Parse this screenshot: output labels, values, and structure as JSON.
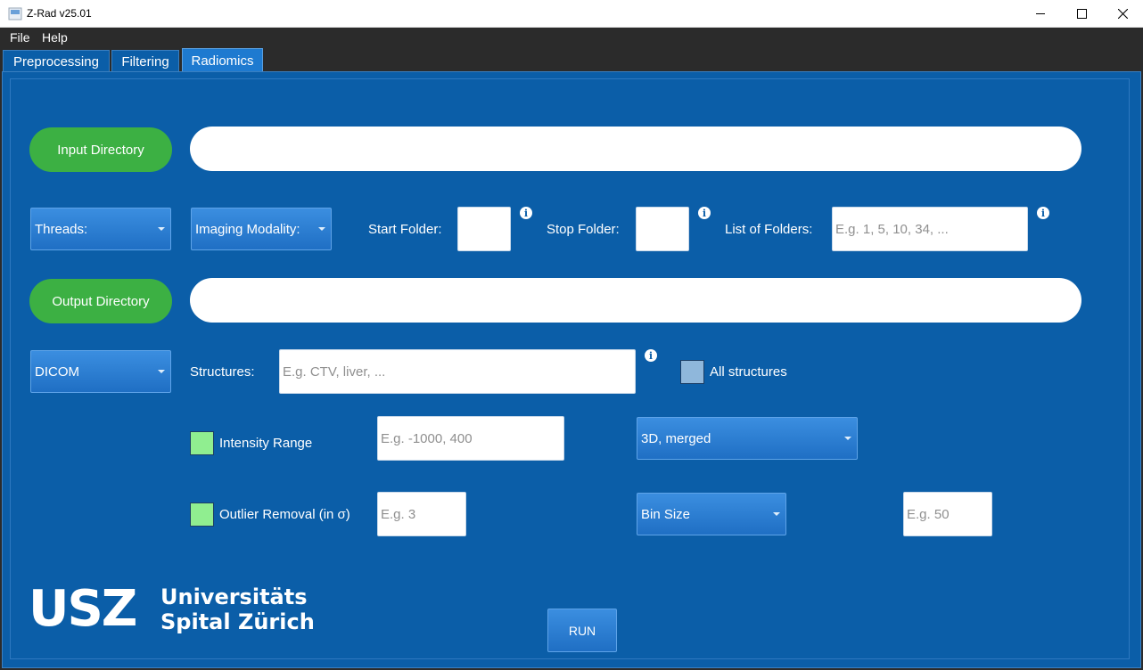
{
  "window": {
    "title": "Z-Rad v25.01",
    "accent": "#0b5ea8",
    "button_green": "#3cb043"
  },
  "menu": [
    "File",
    "Help"
  ],
  "tabs": [
    {
      "label": "Preprocessing",
      "active": false
    },
    {
      "label": "Filtering",
      "active": false
    },
    {
      "label": "Radiomics",
      "active": true
    }
  ],
  "input_dir": {
    "button": "Input Directory",
    "value": ""
  },
  "output_dir": {
    "button": "Output Directory",
    "value": ""
  },
  "row1": {
    "threads": "Threads:",
    "imaging_modality": "Imaging Modality:",
    "start_folder_label": "Start Folder:",
    "start_folder_value": "",
    "stop_folder_label": "Stop Folder:",
    "stop_folder_value": "",
    "folders_label": "List of Folders:",
    "folders_placeholder": "E.g. 1, 5, 10, 34, ..."
  },
  "row2": {
    "format": "DICOM",
    "structures_label": "Structures:",
    "structures_placeholder": "E.g. CTV, liver, ...",
    "all_structures": "All structures"
  },
  "row3": {
    "intensity_label": "Intensity Range",
    "intensity_placeholder": "E.g. -1000, 400",
    "aggregation": "3D, merged"
  },
  "row4": {
    "outlier_label": "Outlier Removal (in σ)",
    "outlier_placeholder": "E.g. 3",
    "bin_mode": "Bin Size",
    "bin_placeholder": "E.g. 50"
  },
  "run": "RUN",
  "logo": {
    "mark": "USZ",
    "line1": "Universitäts",
    "line2": "Spital Zürich"
  },
  "icons": [
    "app-icon",
    "minimize-icon",
    "maximize-icon",
    "close-icon",
    "info-icon",
    "dropdown-arrow-icon"
  ]
}
